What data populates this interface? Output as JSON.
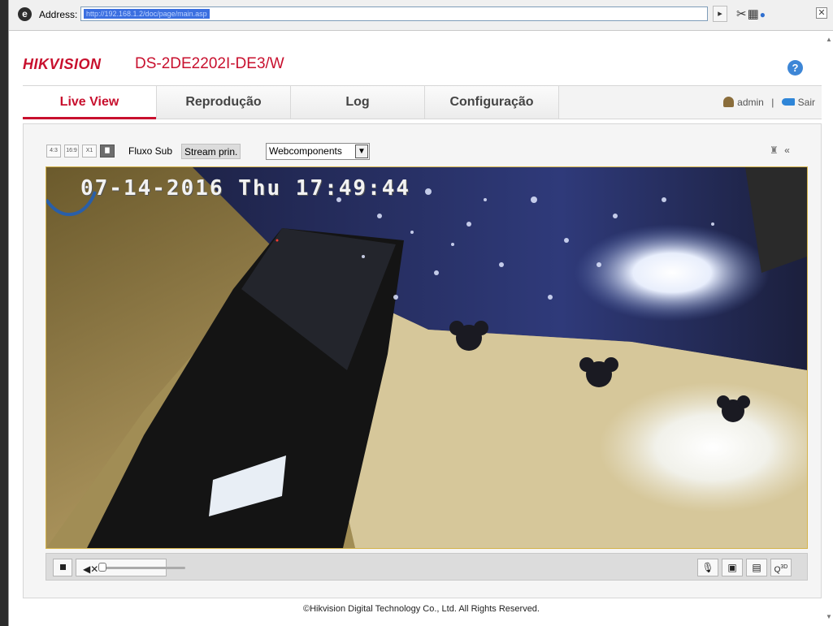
{
  "browser": {
    "address_label": "Address:",
    "address_value": "http://192.168.1.2/doc/page/main.asp"
  },
  "header": {
    "brand": "HIKVISION",
    "model": "DS-2DE2202I-DE3/W",
    "help_icon": "question-icon"
  },
  "tabs": [
    {
      "label": "Live View",
      "active": true
    },
    {
      "label": "Reprodução",
      "active": false
    },
    {
      "label": "Log",
      "active": false
    },
    {
      "label": "Configuração",
      "active": false
    }
  ],
  "user": {
    "name": "admin",
    "separator": "|",
    "logout": "Sair"
  },
  "toolbar": {
    "ratio_4_3": "4:3",
    "ratio_16_9": "16:9",
    "ratio_x1": "X1",
    "stream_sub": "Fluxo Sub",
    "stream_main": "Stream prin.",
    "plugin": "Webcomponents",
    "collapse": "«"
  },
  "video": {
    "osd_timestamp": "07-14-2016 Thu 17:49:44"
  },
  "controls": {
    "volume_level": 0.0
  },
  "footer": {
    "copyright": "©Hikvision Digital Technology Co., Ltd. All Rights Reserved."
  },
  "colors": {
    "brand_red": "#c8102e",
    "help_blue": "#3d86d6",
    "video_border": "#d4b34a"
  }
}
